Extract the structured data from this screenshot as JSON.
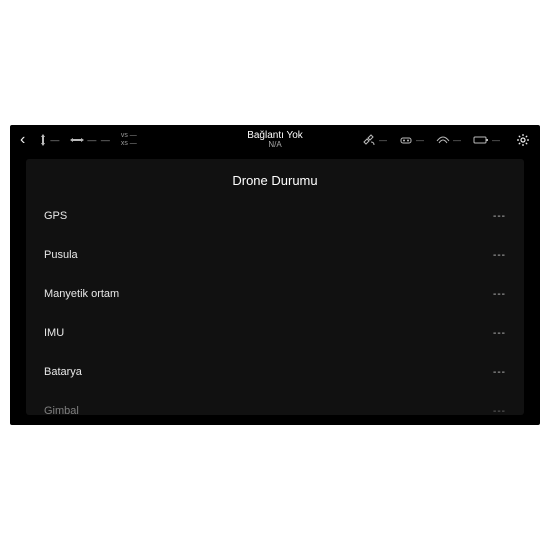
{
  "topbar": {
    "connection_title": "Bağlantı Yok",
    "connection_sub": "N/A",
    "left_readouts": {
      "a": "—",
      "b": "—  —",
      "c_top": "vs —",
      "c_bot": "xs —"
    },
    "right_readouts": {
      "sat": "—",
      "rc": "—",
      "sig": "—",
      "bat": "—"
    }
  },
  "panel": {
    "title": "Drone Durumu",
    "rows": [
      {
        "label": "GPS",
        "value": "---"
      },
      {
        "label": "Pusula",
        "value": "---"
      },
      {
        "label": "Manyetik ortam",
        "value": "---"
      },
      {
        "label": "IMU",
        "value": "---"
      },
      {
        "label": "Batarya",
        "value": "---"
      },
      {
        "label": "Gimbal",
        "value": "---"
      }
    ]
  }
}
